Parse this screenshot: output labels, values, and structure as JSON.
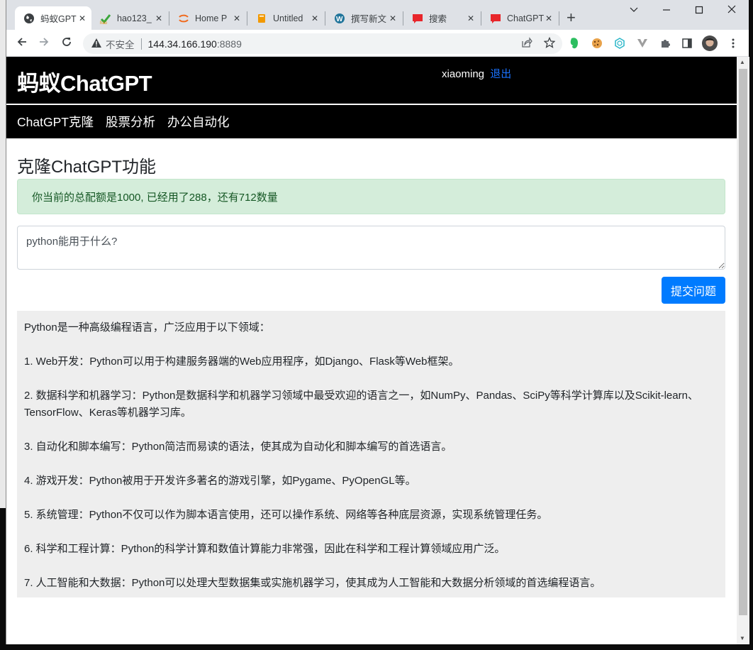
{
  "browser": {
    "tabs": [
      {
        "title": "蚂蚁GPT",
        "icon": "globe-icon",
        "active": true
      },
      {
        "title": "hao123_",
        "icon": "hao123-icon",
        "active": false
      },
      {
        "title": "Home P",
        "icon": "orange-arc-icon",
        "active": false
      },
      {
        "title": "Untitled",
        "icon": "book-icon",
        "active": false
      },
      {
        "title": "撰写新文",
        "icon": "wordpress-icon",
        "active": false
      },
      {
        "title": "搜索",
        "icon": "red-chat-icon",
        "active": false
      },
      {
        "title": "ChatGPT",
        "icon": "red-chat-icon",
        "active": false
      }
    ],
    "new_tab_label": "+",
    "close_glyph": "✕",
    "address": {
      "security_label": "不安全",
      "host": "144.34.166.190",
      "port": ":8889"
    },
    "extensions": [
      "evernote-icon",
      "cookie-icon",
      "web-icon",
      "v-icon",
      "puzzle-icon",
      "sidepanel-icon",
      "profile-avatar",
      "menu-icon"
    ]
  },
  "site": {
    "brand": "蚂蚁ChatGPT",
    "username": "xiaoming",
    "logout_label": "退出",
    "nav": [
      {
        "label": "ChatGPT克隆"
      },
      {
        "label": "股票分析"
      },
      {
        "label": "办公自动化"
      }
    ]
  },
  "main": {
    "title": "克隆ChatGPT功能",
    "quota_message": "你当前的总配额是1000, 已经用了288，还有712数量",
    "quota": {
      "total": 1000,
      "used": 288,
      "remaining": 712
    },
    "question_value": "python能用于什么?",
    "submit_label": "提交问题",
    "answer": [
      "Python是一种高级编程语言，广泛应用于以下领域：",
      "1. Web开发：Python可以用于构建服务器端的Web应用程序，如Django、Flask等Web框架。",
      "2. 数据科学和机器学习：Python是数据科学和机器学习领域中最受欢迎的语言之一，如NumPy、Pandas、SciPy等科学计算库以及Scikit-learn、TensorFlow、Keras等机器学习库。",
      "3. 自动化和脚本编写：Python简洁而易读的语法，使其成为自动化和脚本编写的首选语言。",
      "4. 游戏开发：Python被用于开发许多著名的游戏引擎，如Pygame、PyOpenGL等。",
      "5. 系统管理：Python不仅可以作为脚本语言使用，还可以操作系统、网络等各种底层资源，实现系统管理任务。",
      "6. 科学和工程计算：Python的科学计算和数值计算能力非常强，因此在科学和工程计算领域应用广泛。",
      "7. 人工智能和大数据：Python可以处理大型数据集或实施机器学习，使其成为人工智能和大数据分析领域的首选编程语言。"
    ]
  },
  "colors": {
    "header_bg": "#000000",
    "link_blue": "#1a73ff",
    "primary_button": "#007bff",
    "alert_bg": "#d4edda",
    "alert_text": "#155724",
    "answer_bg": "#eeeeee"
  }
}
